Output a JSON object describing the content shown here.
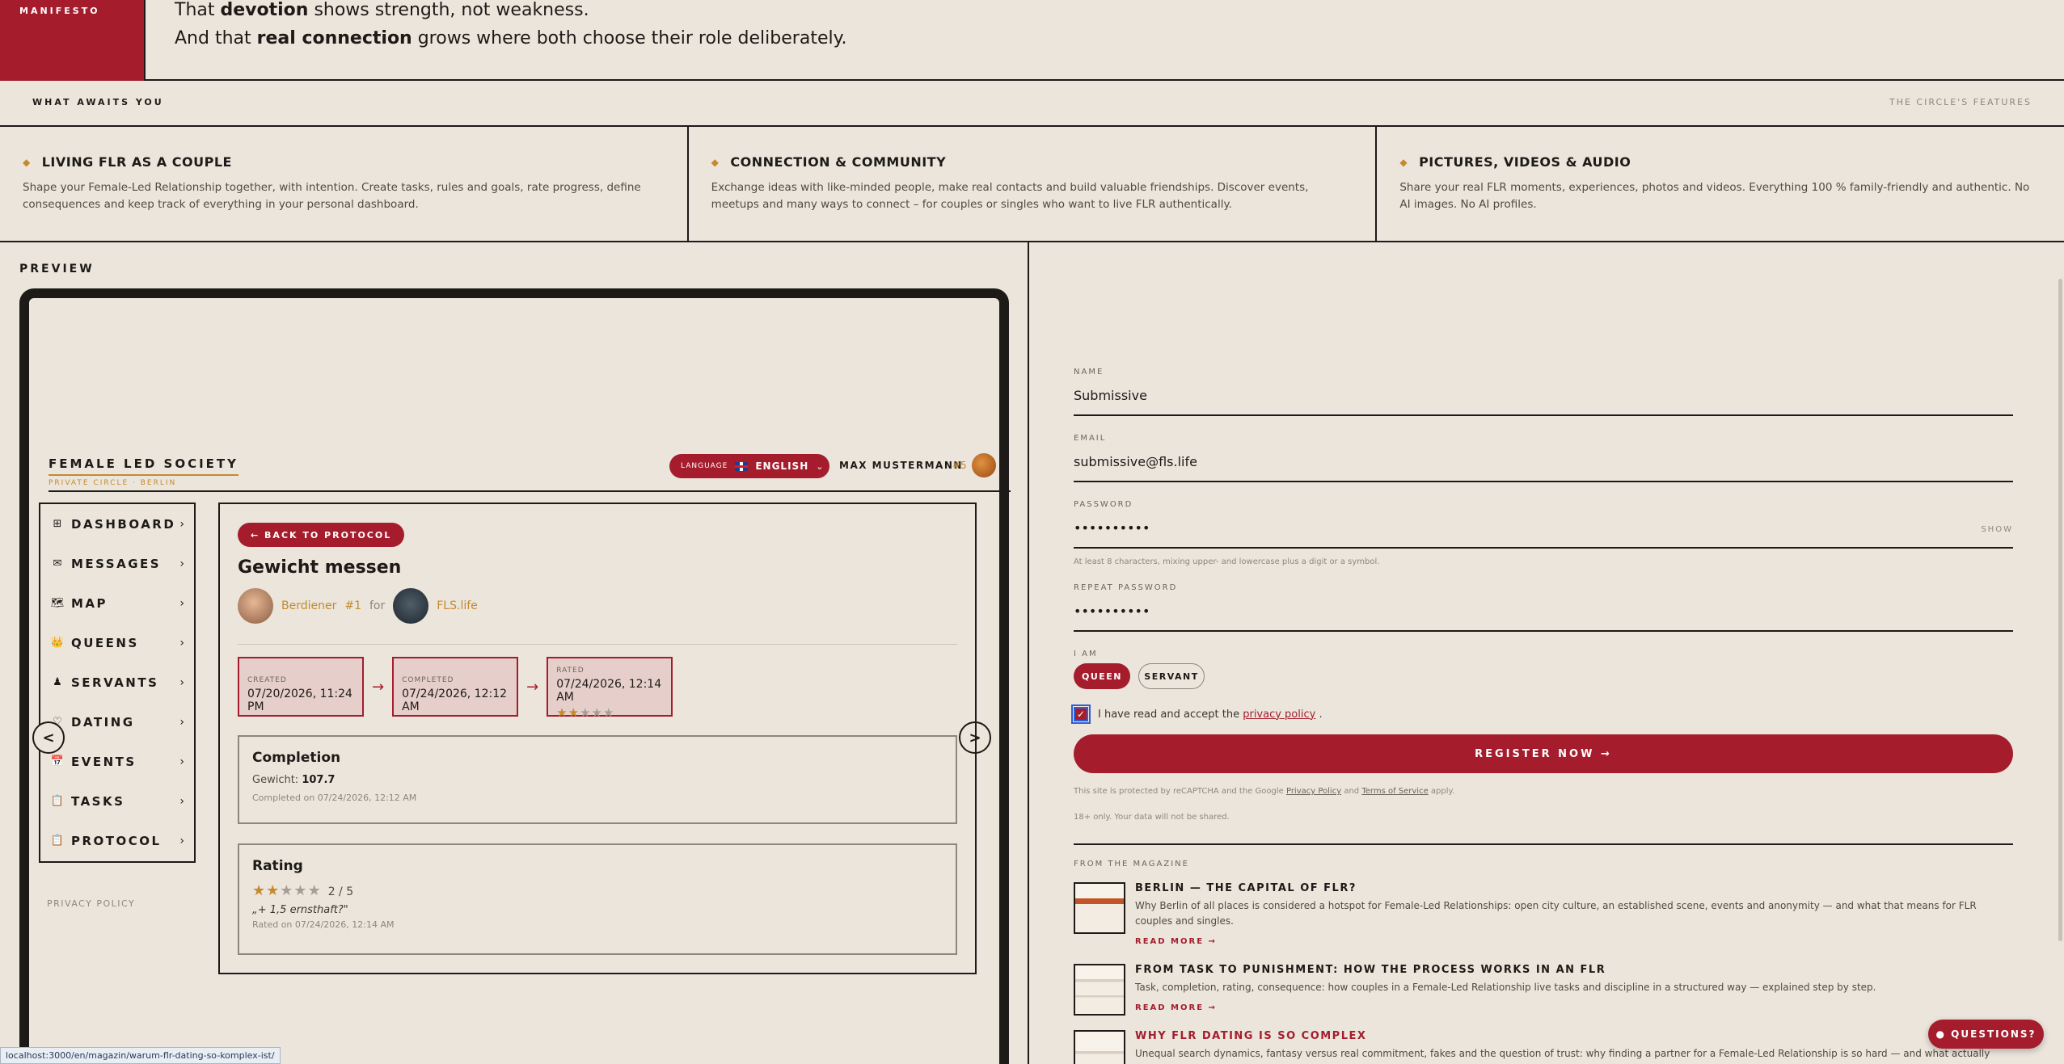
{
  "manifesto": {
    "tag": "MANIFESTO",
    "line1_pre": "That ",
    "line1_bold": "devotion",
    "line1_post": " shows strength, not weakness.",
    "line2_pre": "And that ",
    "line2_bold": "real connection",
    "line2_post": " grows where both choose their role deliberately."
  },
  "awaits": {
    "left": "WHAT AWAITS YOU",
    "right": "THE CIRCLE'S FEATURES"
  },
  "features": [
    {
      "title": "LIVING FLR AS A COUPLE",
      "desc": "Shape your Female-Led Relationship together, with intention. Create tasks, rules and goals, rate progress, define consequences and keep track of everything in your personal dashboard."
    },
    {
      "title": "CONNECTION & COMMUNITY",
      "desc": "Exchange ideas with like-minded people, make real contacts and build valuable friendships. Discover events, meetups and many ways to connect – for couples or singles who want to live FLR authentically."
    },
    {
      "title": "PICTURES, VIDEOS & AUDIO",
      "desc": "Share your real FLR moments, experiences, photos and videos. Everything 100 % family-friendly and authentic. No AI images. No AI profiles."
    }
  ],
  "preview": {
    "label": "PREVIEW",
    "brand_title": "FEMALE LED SOCIETY",
    "brand_sub": "PRIVATE CIRCLE · BERLIN",
    "language_label": "LANGUAGE",
    "language_value": "ENGLISH",
    "user_name": "MAX MUSTERMANN",
    "user_num": "#5",
    "nav": [
      {
        "icon": "⊞",
        "label": "DASHBOARD"
      },
      {
        "icon": "✉",
        "label": "MESSAGES"
      },
      {
        "icon": "🗺",
        "label": "MAP"
      },
      {
        "icon": "👑",
        "label": "QUEENS"
      },
      {
        "icon": "♟",
        "label": "SERVANTS"
      },
      {
        "icon": "♡",
        "label": "DATING"
      },
      {
        "icon": "📅",
        "label": "EVENTS"
      },
      {
        "icon": "📋",
        "label": "TASKS"
      },
      {
        "icon": "📋",
        "label": "PROTOCOL"
      }
    ],
    "privacy": "PRIVACY POLICY",
    "prev_arrow": "<",
    "next_arrow": ">",
    "back": "← BACK TO PROTOCOL",
    "task_title": "Gewicht messen",
    "from_name": "Berdiener",
    "from_num": "#1",
    "for_word": "for",
    "to_name": "FLS.life",
    "steps": [
      {
        "label": "CREATED",
        "value": "07/20/2026, 11:24 PM"
      },
      {
        "label": "COMPLETED",
        "value": "07/24/2026, 12:12 AM"
      },
      {
        "label": "RATED",
        "value": "07/24/2026, 12:14 AM",
        "rating": 2,
        "max": 5
      }
    ],
    "completion": {
      "heading": "Completion",
      "field_label": "Gewicht:",
      "field_value": "107.7",
      "note": "Completed on 07/24/2026, 12:12 AM"
    },
    "rating_box": {
      "heading": "Rating",
      "score": "2 / 5",
      "rating": 2,
      "quote": "„+ 1,5 ernsthaft?\"",
      "note": "Rated on 07/24/2026, 12:14 AM"
    }
  },
  "form": {
    "name_label": "NAME",
    "name_value": "Submissive",
    "email_label": "EMAIL",
    "email_value": "submissive@fls.life",
    "password_label": "PASSWORD",
    "password_value": "••••••••••",
    "show": "SHOW",
    "password_hint": "At least 8 characters, mixing upper- and lowercase plus a digit or a symbol.",
    "repeat_label": "REPEAT PASSWORD",
    "repeat_value": "••••••••••",
    "role_label": "I AM",
    "role_queen": "QUEEN",
    "role_servant": "SERVANT",
    "consent_pre": "I have read and accept the",
    "consent_link": "privacy policy",
    "consent_post": ".",
    "register": "REGISTER NOW →",
    "recaptcha_pre": "This site is protected by reCAPTCHA and the Google",
    "recaptcha_privacy": "Privacy Policy",
    "recaptcha_and": "and",
    "recaptcha_terms": "Terms of Service",
    "recaptcha_post": "apply.",
    "age": "18+ only. Your data will not be shared."
  },
  "magazine": {
    "label": "FROM THE MAGAZINE",
    "read_more": "READ MORE →",
    "articles": [
      {
        "title": "BERLIN — THE CAPITAL OF FLR?",
        "desc": "Why Berlin of all places is considered a hotspot for Female-Led Relationships: open city culture, an established scene, events and anonymity — and what that means for FLR couples and singles."
      },
      {
        "title": "FROM TASK TO PUNISHMENT: HOW THE PROCESS WORKS IN AN FLR",
        "desc": "Task, completion, rating, consequence: how couples in a Female-Led Relationship live tasks and discipline in a structured way — explained step by step."
      },
      {
        "title": "WHY FLR DATING IS SO COMPLEX",
        "desc": "Unequal search dynamics, fantasy versus real commitment, fakes and the question of trust: why finding a partner for a Female-Led Relationship is so hard — and what actually helps."
      }
    ]
  },
  "questions": "● QUESTIONS?",
  "status_url": "localhost:3000/en/magazin/warum-flr-dating-so-komplex-ist/"
}
